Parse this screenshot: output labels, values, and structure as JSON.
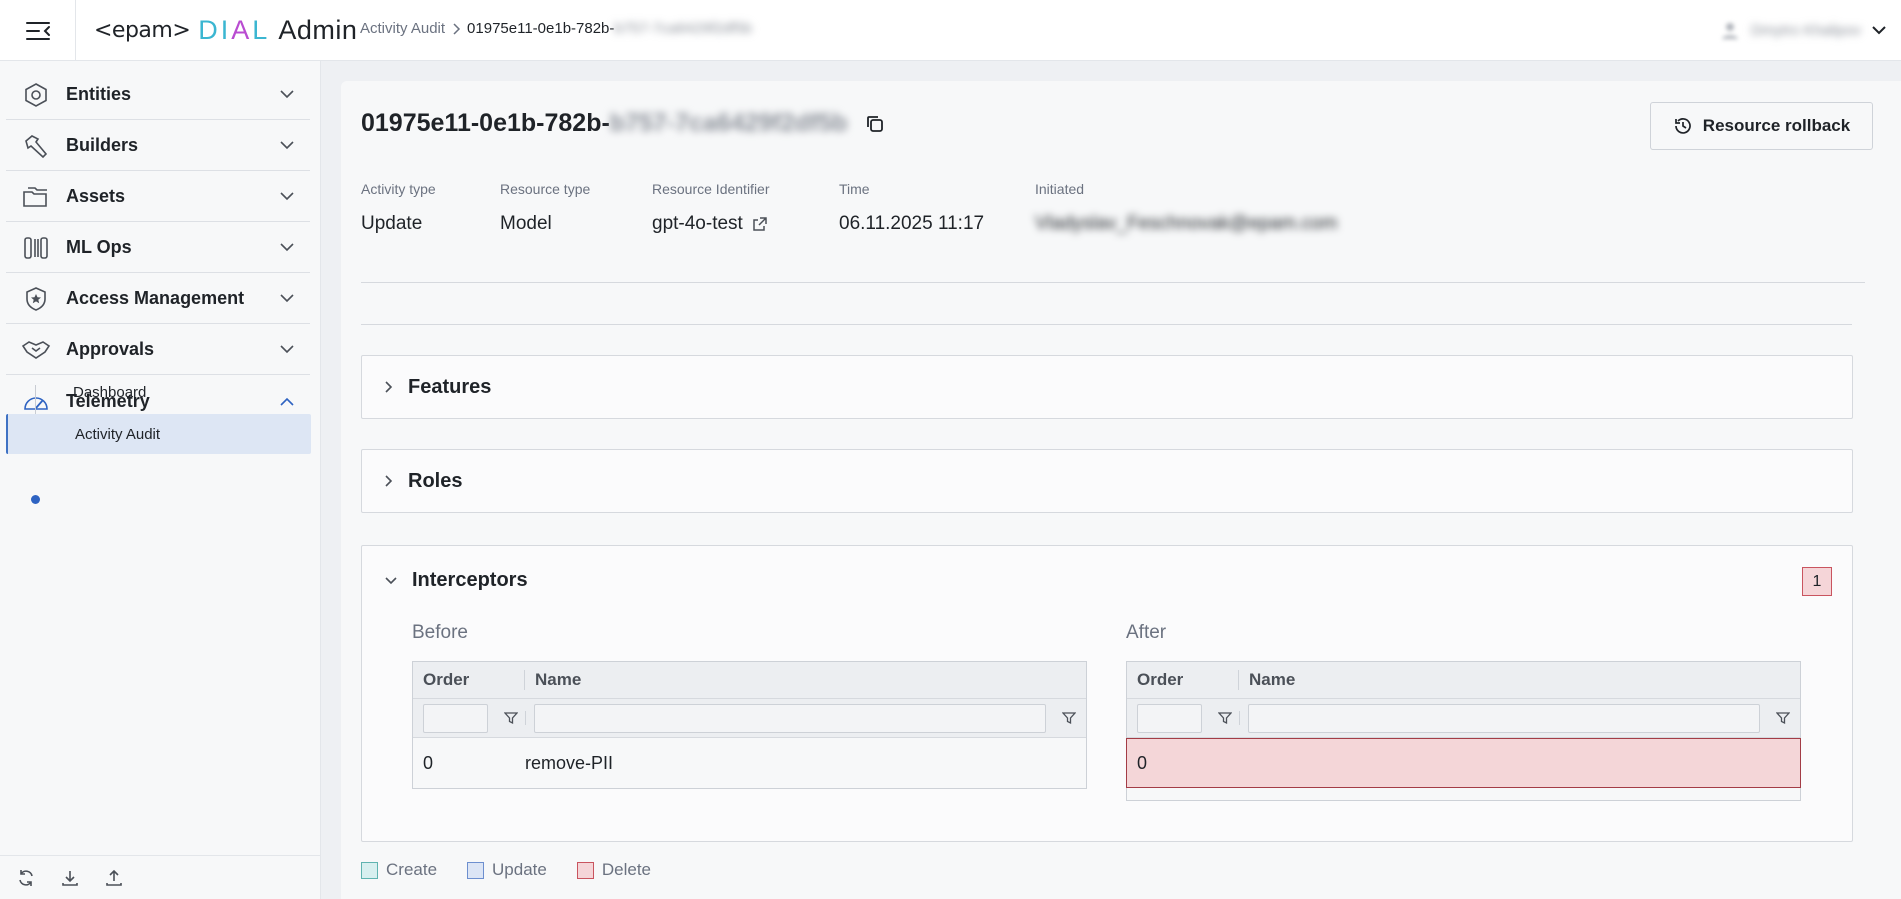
{
  "header": {
    "logo_epam": "<epam>",
    "logo_dial_1": "DI",
    "logo_dial_2": "A",
    "logo_dial_3": "L",
    "logo_admin": "Admin",
    "breadcrumb_parent": "Activity Audit",
    "breadcrumb_current_visible": "01975e11-0e1b-782b-",
    "breadcrumb_current_blurred": "b757-7ca6429f2df5b",
    "user_name": "Dmytro Khalipov"
  },
  "sidebar": {
    "items": [
      {
        "label": "Entities",
        "icon": "hexagon-icon"
      },
      {
        "label": "Builders",
        "icon": "hammer-icon"
      },
      {
        "label": "Assets",
        "icon": "folders-icon"
      },
      {
        "label": "ML Ops",
        "icon": "tools-icon"
      },
      {
        "label": "Access Management",
        "icon": "shield-star-icon"
      },
      {
        "label": "Approvals",
        "icon": "handshake-icon"
      },
      {
        "label": "Telemetry",
        "icon": "gauge-icon"
      }
    ],
    "telemetry_children": [
      "Dashboard",
      "Activity Audit"
    ]
  },
  "main": {
    "title_visible": "01975e11-0e1b-782b-",
    "title_blurred": "b757-7ca6429f2df5b",
    "rollback_label": "Resource rollback",
    "meta": {
      "activity_type_label": "Activity type",
      "activity_type_value": "Update",
      "resource_type_label": "Resource type",
      "resource_type_value": "Model",
      "resource_id_label": "Resource Identifier",
      "resource_id_value": "gpt-4o-test",
      "time_label": "Time",
      "time_value": "06.11.2025 11:17",
      "initiated_label": "Initiated",
      "initiated_value": "Vladyslav_Feschnovak@epam.com"
    },
    "sections": {
      "features": "Features",
      "roles": "Roles",
      "interceptors": "Interceptors"
    },
    "interceptors": {
      "badge": "1",
      "before_label": "Before",
      "after_label": "After",
      "columns": [
        "Order",
        "Name"
      ],
      "before_rows": [
        {
          "order": "0",
          "name": "remove-PII"
        }
      ],
      "after_rows": [
        {
          "order": "0",
          "name": ""
        }
      ]
    },
    "legend": {
      "create": "Create",
      "update": "Update",
      "delete": "Delete",
      "colors": {
        "create": "#d7efef",
        "update": "#dce5f5",
        "delete": "#f5d5d8"
      }
    }
  }
}
